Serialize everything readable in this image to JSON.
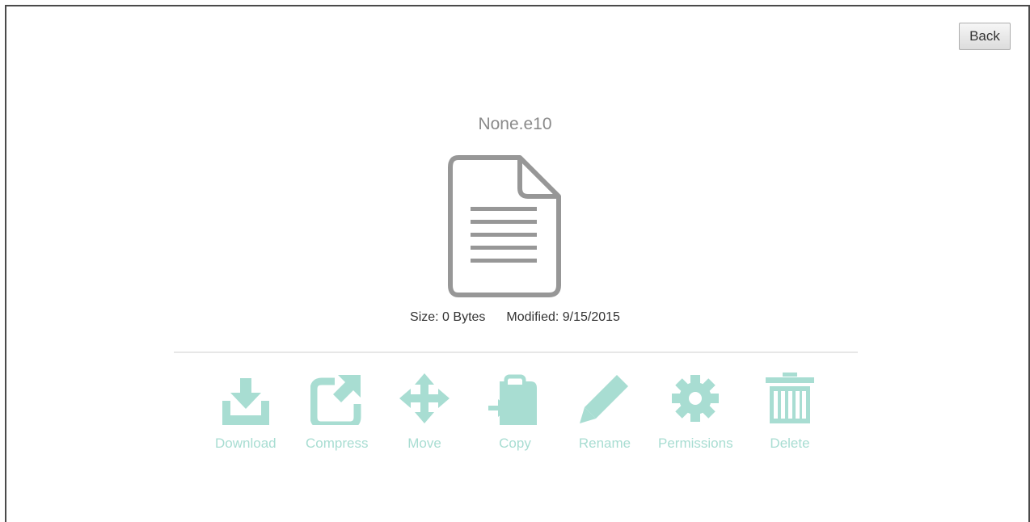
{
  "toolbar": {
    "back_label": "Back"
  },
  "file": {
    "name": "None.e10",
    "size": "Size: 0 Bytes",
    "modified": "Modified: 9/15/2015",
    "icon": "document-icon"
  },
  "colors": {
    "action": "#a8ddd2",
    "file_icon": "#979797",
    "text": "#333333",
    "muted_text": "#8a8a8a",
    "divider": "#e7e7e7"
  },
  "actions": [
    {
      "label": "Download",
      "icon": "download-icon"
    },
    {
      "label": "Compress",
      "icon": "external-link-icon"
    },
    {
      "label": "Move",
      "icon": "move-arrows-icon"
    },
    {
      "label": "Copy",
      "icon": "paste-clipboard-icon"
    },
    {
      "label": "Rename",
      "icon": "pencil-icon"
    },
    {
      "label": "Permissions",
      "icon": "gear-icon"
    },
    {
      "label": "Delete",
      "icon": "trash-icon"
    }
  ]
}
